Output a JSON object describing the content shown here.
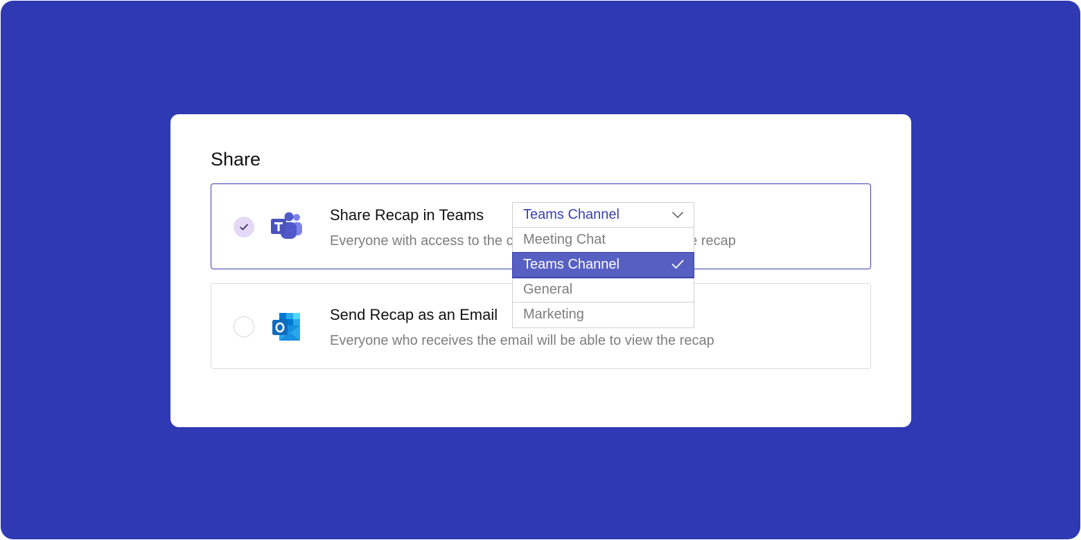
{
  "share": {
    "title": "Share",
    "options": [
      {
        "title": "Share Recap in Teams",
        "description": "Everyone with access to the channel will be able to view the recap",
        "selected": true,
        "icon": "microsoft-teams-icon"
      },
      {
        "title": "Send Recap as an Email",
        "description": "Everyone who receives the email will be able to view the recap",
        "selected": false,
        "icon": "microsoft-outlook-icon"
      }
    ]
  },
  "dropdown": {
    "selected": "Teams Channel",
    "items": [
      "Meeting Chat",
      "Teams Channel",
      "General",
      "Marketing"
    ],
    "active_index": 1
  },
  "colors": {
    "background": "#2e39b3",
    "accent": "#3a3fb0",
    "highlight": "#5760c2",
    "radio_checked": "#e5d8f6"
  }
}
